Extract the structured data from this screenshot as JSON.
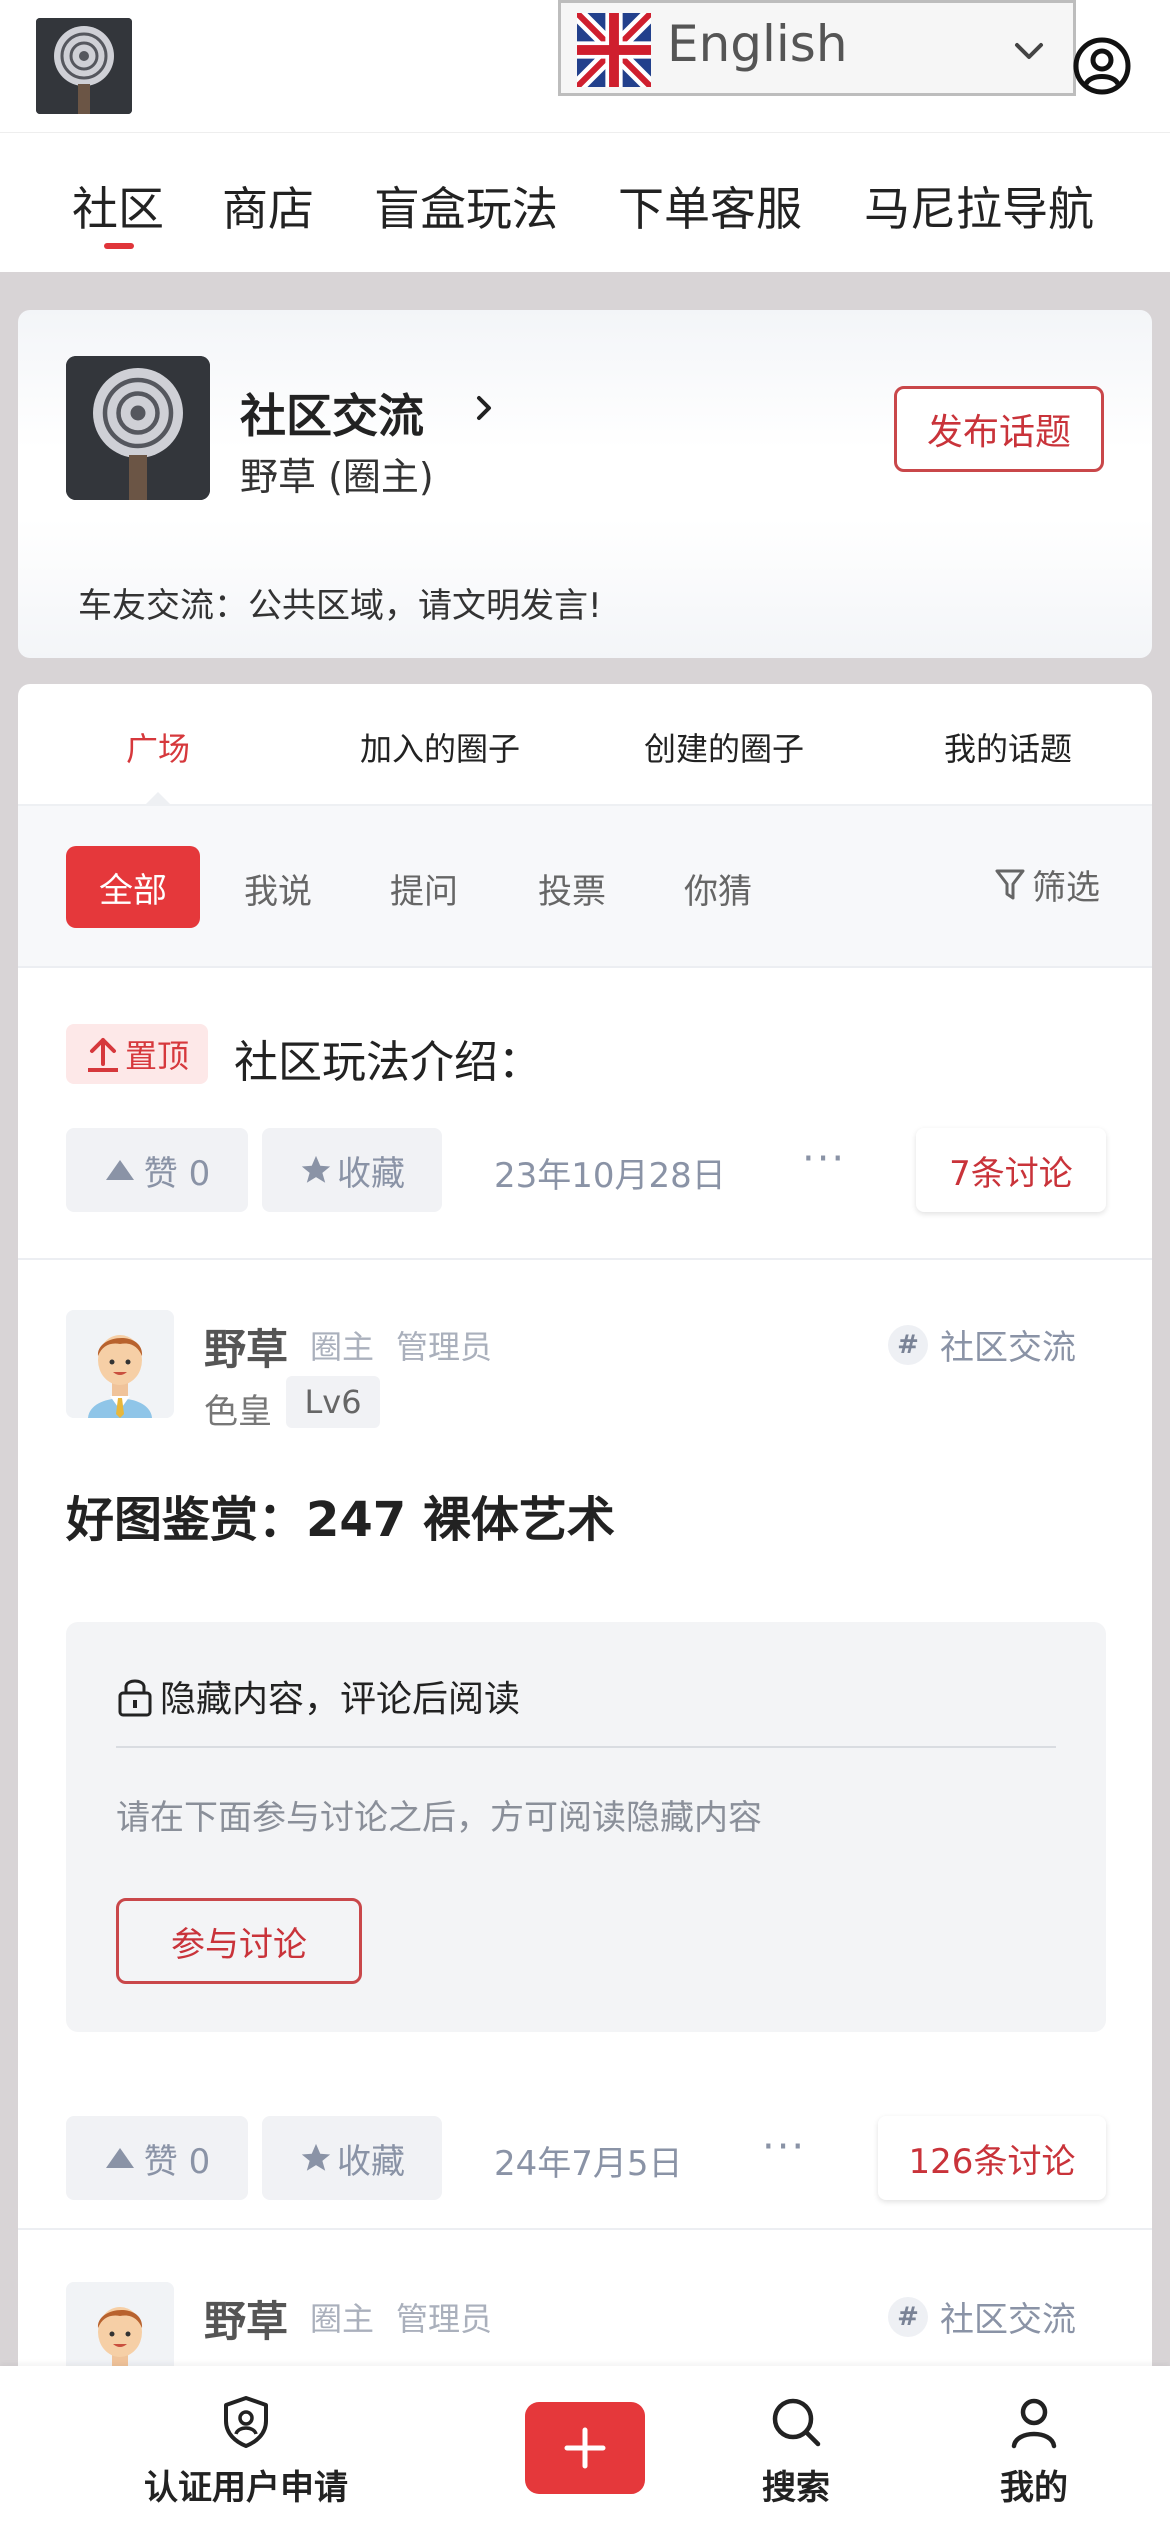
{
  "language": {
    "label": "English"
  },
  "nav": {
    "items": [
      "社区",
      "商店",
      "盲盒玩法",
      "下单客服",
      "马尼拉导航"
    ],
    "active_color": "#e0353a"
  },
  "circle": {
    "title": "社区交流",
    "owner": "野草 (圈主)",
    "publish_button": "发布话题",
    "notice": "车友交流：公共区域，请文明发言!"
  },
  "tabs": [
    "广场",
    "加入的圈子",
    "创建的圈子",
    "我的话题"
  ],
  "filters": {
    "active": "全部",
    "items": [
      "我说",
      "提问",
      "投票",
      "你猜"
    ],
    "filter_label": "筛选"
  },
  "pinned_post": {
    "badge": "置顶",
    "title": "社区玩法介绍：",
    "like_label": "赞 0",
    "fav_label": "收藏",
    "date": "23年10月28日",
    "more": "···",
    "discussions": "7条讨论"
  },
  "posts": [
    {
      "author": "野草",
      "role1": "圈主",
      "role2": "管理员",
      "tag": "社区交流",
      "level_label": "色皇",
      "level": "Lv6",
      "title": "好图鉴赏：247 裸体艺术",
      "hidden": {
        "heading": "隐藏内容，评论后阅读",
        "desc": "请在下面参与讨论之后，方可阅读隐藏内容",
        "button": "参与讨论"
      },
      "like_label": "赞 0",
      "fav_label": "收藏",
      "date": "24年7月5日",
      "more": "···",
      "discussions": "126条讨论"
    },
    {
      "author": "野草",
      "role1": "圈主",
      "role2": "管理员",
      "tag": "社区交流"
    }
  ],
  "bottom_nav": {
    "verify": "认证用户申请",
    "search": "搜索",
    "mine": "我的",
    "plus": "+"
  },
  "icons": [
    "uk-flag-icon",
    "chevron-down-icon",
    "user-circle-icon",
    "chevron-right-icon",
    "funnel-icon",
    "upload-icon",
    "triangle-up-icon",
    "star-icon",
    "hash-icon",
    "lock-icon",
    "shield-user-icon",
    "search-icon",
    "person-icon"
  ]
}
